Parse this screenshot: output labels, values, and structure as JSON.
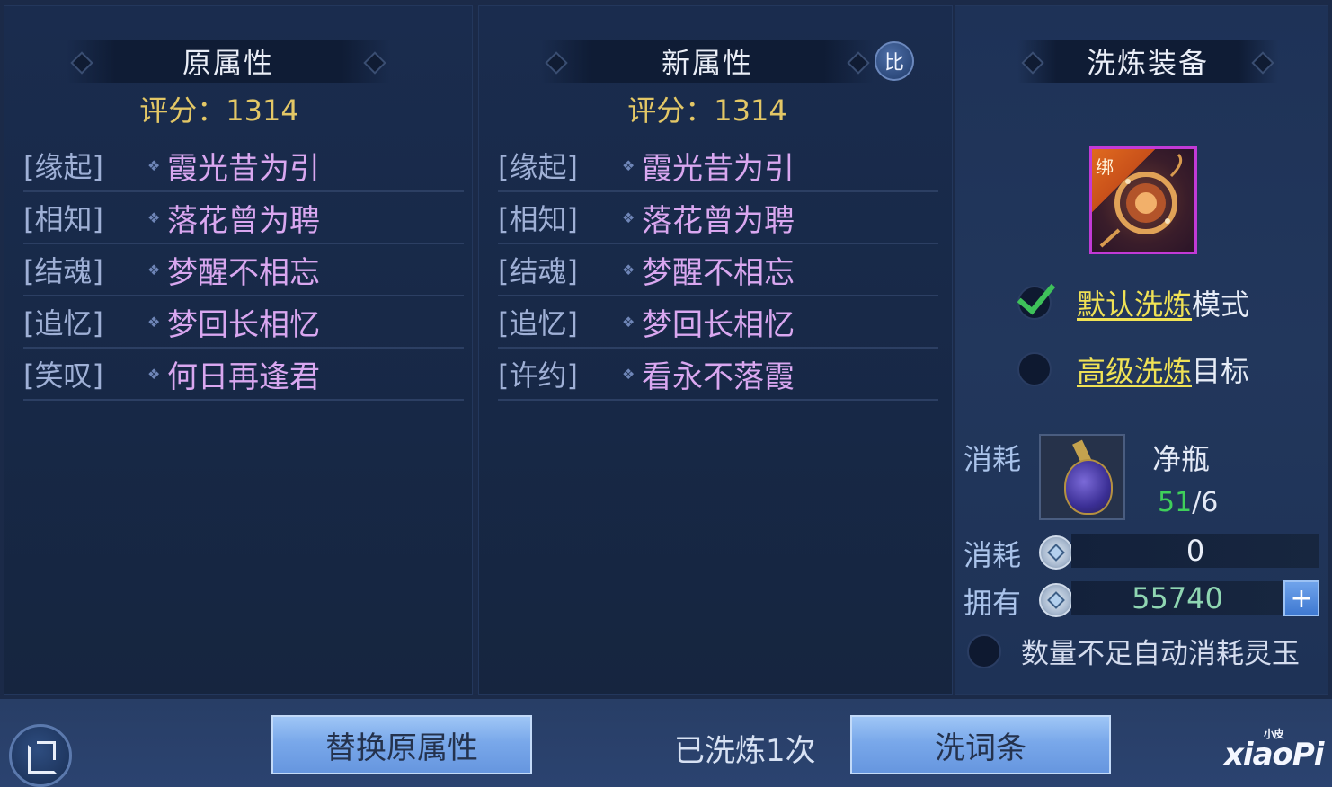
{
  "original": {
    "title": "原属性",
    "score_label": "评分：1314",
    "attributes": [
      {
        "tag": "[缘起]",
        "name": "霞光昔为引"
      },
      {
        "tag": "[相知]",
        "name": "落花曾为聘"
      },
      {
        "tag": "[结魂]",
        "name": "梦醒不相忘"
      },
      {
        "tag": "[追忆]",
        "name": "梦回长相忆"
      },
      {
        "tag": "[笑叹]",
        "name": "何日再逢君"
      }
    ]
  },
  "new": {
    "title": "新属性",
    "compare_label": "比",
    "score_label": "评分：1314",
    "attributes": [
      {
        "tag": "[缘起]",
        "name": "霞光昔为引"
      },
      {
        "tag": "[相知]",
        "name": "落花曾为聘"
      },
      {
        "tag": "[结魂]",
        "name": "梦醒不相忘"
      },
      {
        "tag": "[追忆]",
        "name": "梦回长相忆"
      },
      {
        "tag": "[许约]",
        "name": "看永不落霞"
      }
    ]
  },
  "wash": {
    "title": "洗炼装备",
    "bind_label": "绑",
    "default_mode": {
      "link": "默认洗炼",
      "suffix": "模式",
      "selected": true
    },
    "advanced_mode": {
      "link": "高级洗炼",
      "suffix": "目标",
      "selected": false
    },
    "cost_label": "消耗",
    "material_name": "净瓶",
    "material_have": "51",
    "material_need": "/6",
    "coin_cost_label": "消耗",
    "coin_cost_value": "0",
    "own_label": "拥有",
    "own_value": "55740",
    "plus_label": "+",
    "auto_label": "数量不足自动消耗灵玉"
  },
  "bottom": {
    "replace_button": "替换原属性",
    "wash_count": "已洗炼1次",
    "wash_button": "洗词条",
    "watermark": "xiaoPi",
    "watermark_small": "小皮"
  },
  "colors": {
    "attribute_name": "#d9a7f0",
    "score": "#e3c766",
    "mode_link": "#f0e255",
    "have_count": "#3fcf5a",
    "own_value": "#8fd6b2"
  }
}
